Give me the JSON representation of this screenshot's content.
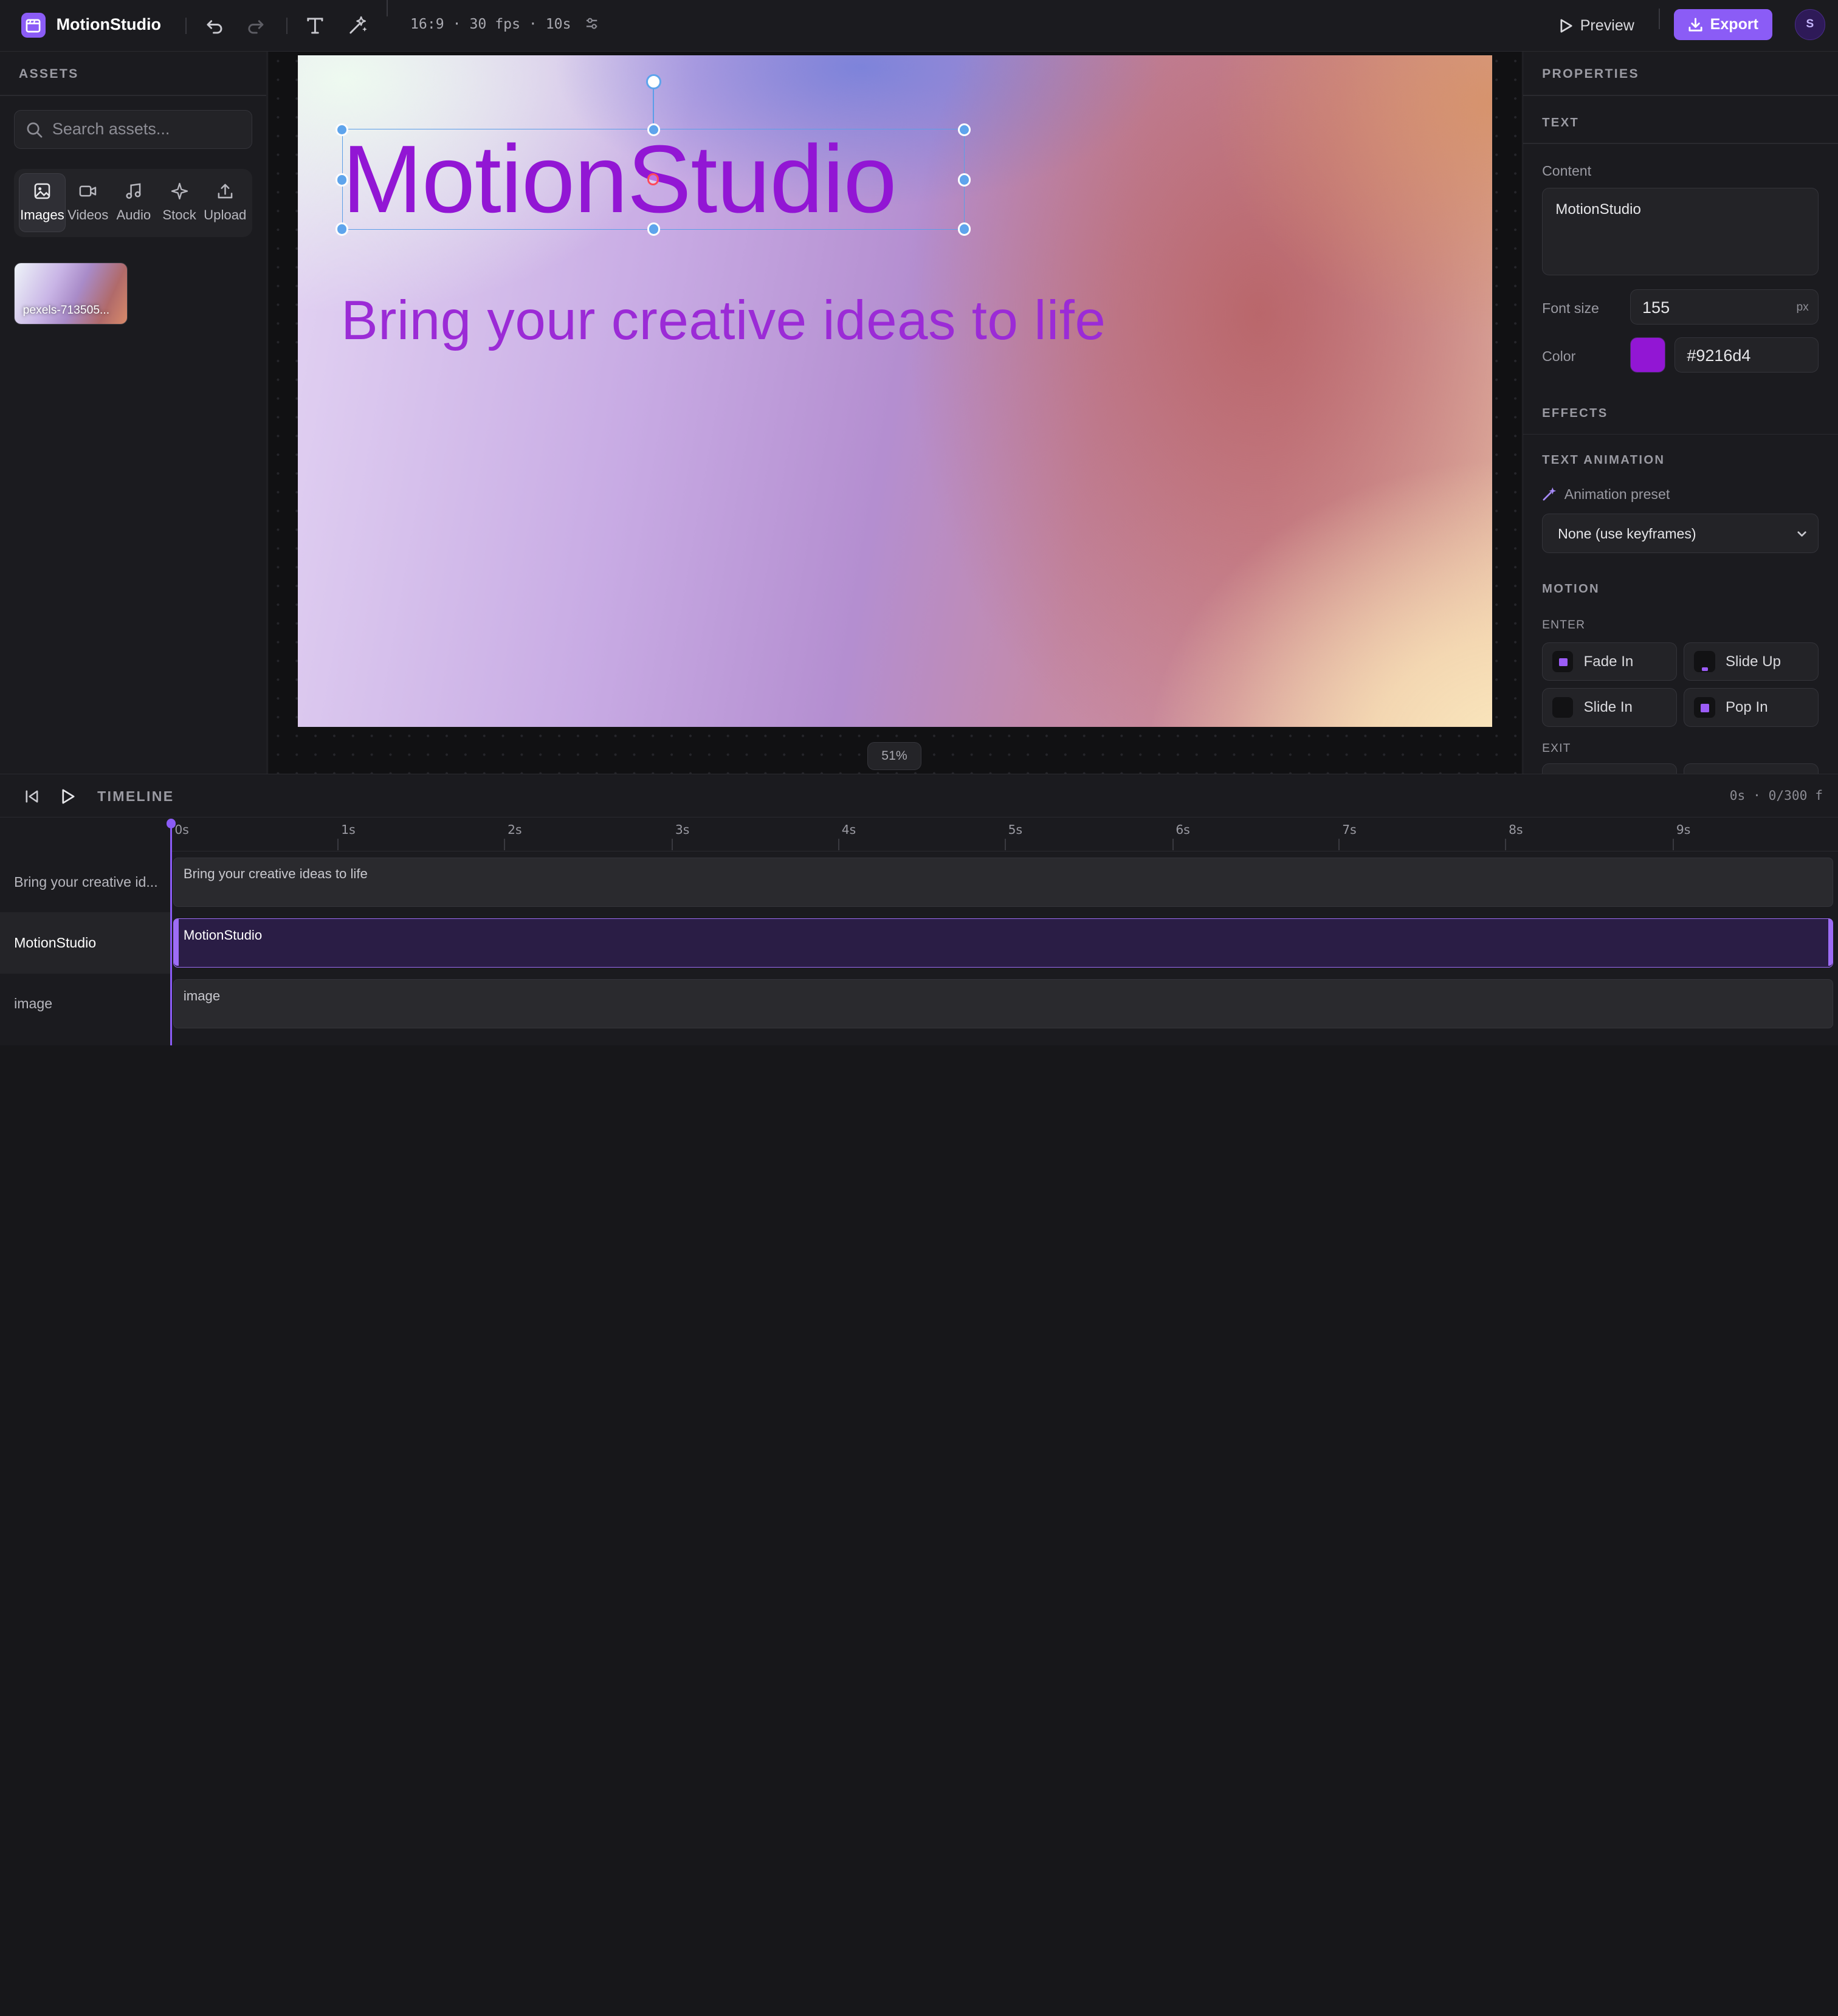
{
  "header": {
    "app_name": "MotionStudio",
    "project_meta": "16:9 · 30 fps · 10s",
    "preview_label": "Preview",
    "export_label": "Export",
    "avatar_initial": "S"
  },
  "assets": {
    "title": "ASSETS",
    "search_placeholder": "Search assets...",
    "tabs": [
      {
        "label": "Images",
        "icon": "image-icon",
        "active": true
      },
      {
        "label": "Videos",
        "icon": "video-icon",
        "active": false
      },
      {
        "label": "Audio",
        "icon": "music-icon",
        "active": false
      },
      {
        "label": "Stock",
        "icon": "sparkle-icon",
        "active": false
      },
      {
        "label": "Upload",
        "icon": "upload-icon",
        "active": false
      }
    ],
    "items": [
      {
        "name": "pexels-713505..."
      }
    ]
  },
  "canvas": {
    "title_text": "MotionStudio",
    "subtitle_text": "Bring your creative ideas to life",
    "zoom": "51%"
  },
  "properties": {
    "title": "PROPERTIES",
    "text_section": "TEXT",
    "content_label": "Content",
    "content_value": "MotionStudio",
    "font_size_label": "Font size",
    "font_size_value": "155",
    "font_size_unit": "px",
    "color_label": "Color",
    "color_value": "#9216d4",
    "effects_section": "EFFECTS",
    "text_animation_section": "TEXT ANIMATION",
    "animation_preset_label": "Animation preset",
    "animation_preset_value": "None (use keyframes)",
    "motion_section": "MOTION",
    "enter_label": "ENTER",
    "enter_effects": [
      "Fade In",
      "Slide Up",
      "Slide In",
      "Pop In"
    ],
    "exit_label": "EXIT"
  },
  "timeline": {
    "title": "TIMELINE",
    "time_readout": "0s · 0/300 f",
    "ticks": [
      "0s",
      "1s",
      "2s",
      "3s",
      "4s",
      "5s",
      "6s",
      "7s",
      "8s",
      "9s"
    ],
    "tracks": [
      {
        "label": "Bring your creative id...",
        "clip": "Bring your creative ideas to life",
        "active": false
      },
      {
        "label": "MotionStudio",
        "clip": "MotionStudio",
        "active": true
      },
      {
        "label": "image",
        "clip": "image",
        "active": false
      }
    ]
  },
  "colors": {
    "accent": "#8b5cf6",
    "text_color": "#9216d4",
    "selection": "#5b9ee8"
  }
}
